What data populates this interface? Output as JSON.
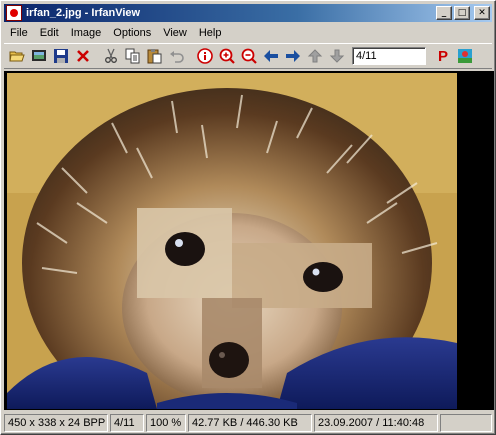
{
  "window": {
    "title": "irfan_2.jpg - IrfanView",
    "minimize_glyph": "_",
    "maximize_glyph": "□",
    "close_glyph": "✕"
  },
  "menu": {
    "items": [
      {
        "label": "File"
      },
      {
        "label": "Edit"
      },
      {
        "label": "Image"
      },
      {
        "label": "Options"
      },
      {
        "label": "View"
      },
      {
        "label": "Help"
      }
    ]
  },
  "toolbar": {
    "buttons": [
      {
        "icon": "open-folder-icon"
      },
      {
        "icon": "slideshow-icon"
      },
      {
        "icon": "save-icon"
      },
      {
        "icon": "delete-icon"
      },
      {
        "icon": "cut-icon"
      },
      {
        "icon": "copy-icon"
      },
      {
        "icon": "paste-icon"
      },
      {
        "icon": "undo-icon"
      },
      {
        "icon": "info-icon"
      },
      {
        "icon": "zoom-in-icon"
      },
      {
        "icon": "zoom-out-icon"
      },
      {
        "icon": "previous-arrow-icon"
      },
      {
        "icon": "next-arrow-icon"
      },
      {
        "icon": "first-file-icon"
      },
      {
        "icon": "last-file-icon"
      },
      {
        "icon": "print-icon"
      },
      {
        "icon": "irfanview-logo-icon"
      }
    ],
    "page_field": "4/11",
    "print_glyph": "P"
  },
  "colors": {
    "accent": "#0a246a",
    "delete_red": "#cc0000",
    "nav_blue": "#1a4fa0",
    "info_red": "#cc0000"
  },
  "statusbar": {
    "dimensions": "450 x 338 x 24 BPP",
    "page": "4/11",
    "zoom": "100 %",
    "size": "42.77 KB / 446.30 KB",
    "datetime": "23.09.2007 / 11:40:48"
  }
}
